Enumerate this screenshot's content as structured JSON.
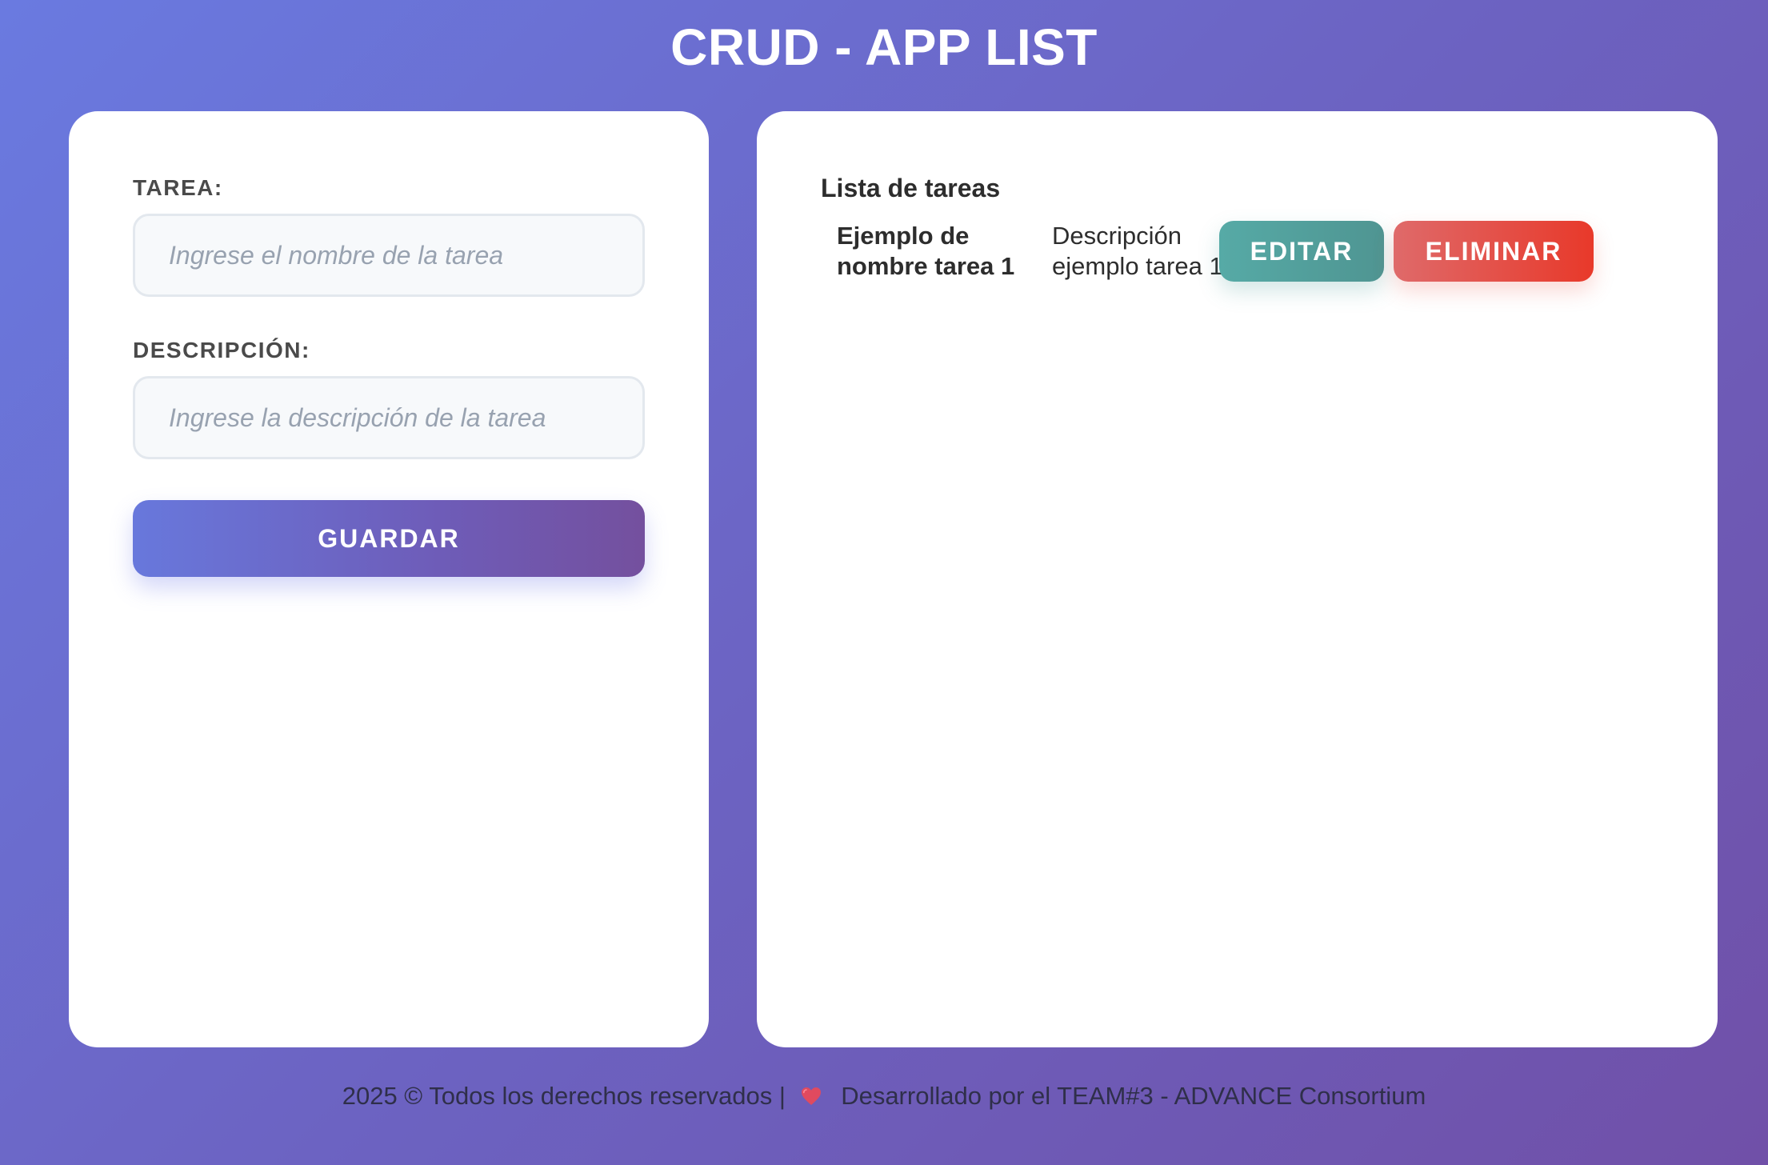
{
  "header": {
    "title": "CRUD - APP LIST"
  },
  "form": {
    "task_label": "TAREA:",
    "task_placeholder": "Ingrese el nombre de la tarea",
    "task_value": "",
    "description_label": "DESCRIPCIÓN:",
    "description_placeholder": "Ingrese la descripción de la tarea",
    "description_value": "",
    "save_label": "GUARDAR"
  },
  "list": {
    "heading": "Lista de tareas",
    "items": [
      {
        "name": "Ejemplo de nombre tarea 1",
        "description": "Descripción ejemplo tarea 1",
        "edit_label": "EDITAR",
        "delete_label": "ELIMINAR"
      }
    ]
  },
  "footer": {
    "left_text": "2025 © Todos los derechos reservados |",
    "icon": "heart-icon",
    "right_text": "Desarrollado por el TEAM#3 - ADVANCE Consortium"
  },
  "colors": {
    "accent": "#6a7ae0",
    "edit": "#56aaa6",
    "delete": "#e8392a",
    "heart": "#e04a5f"
  }
}
